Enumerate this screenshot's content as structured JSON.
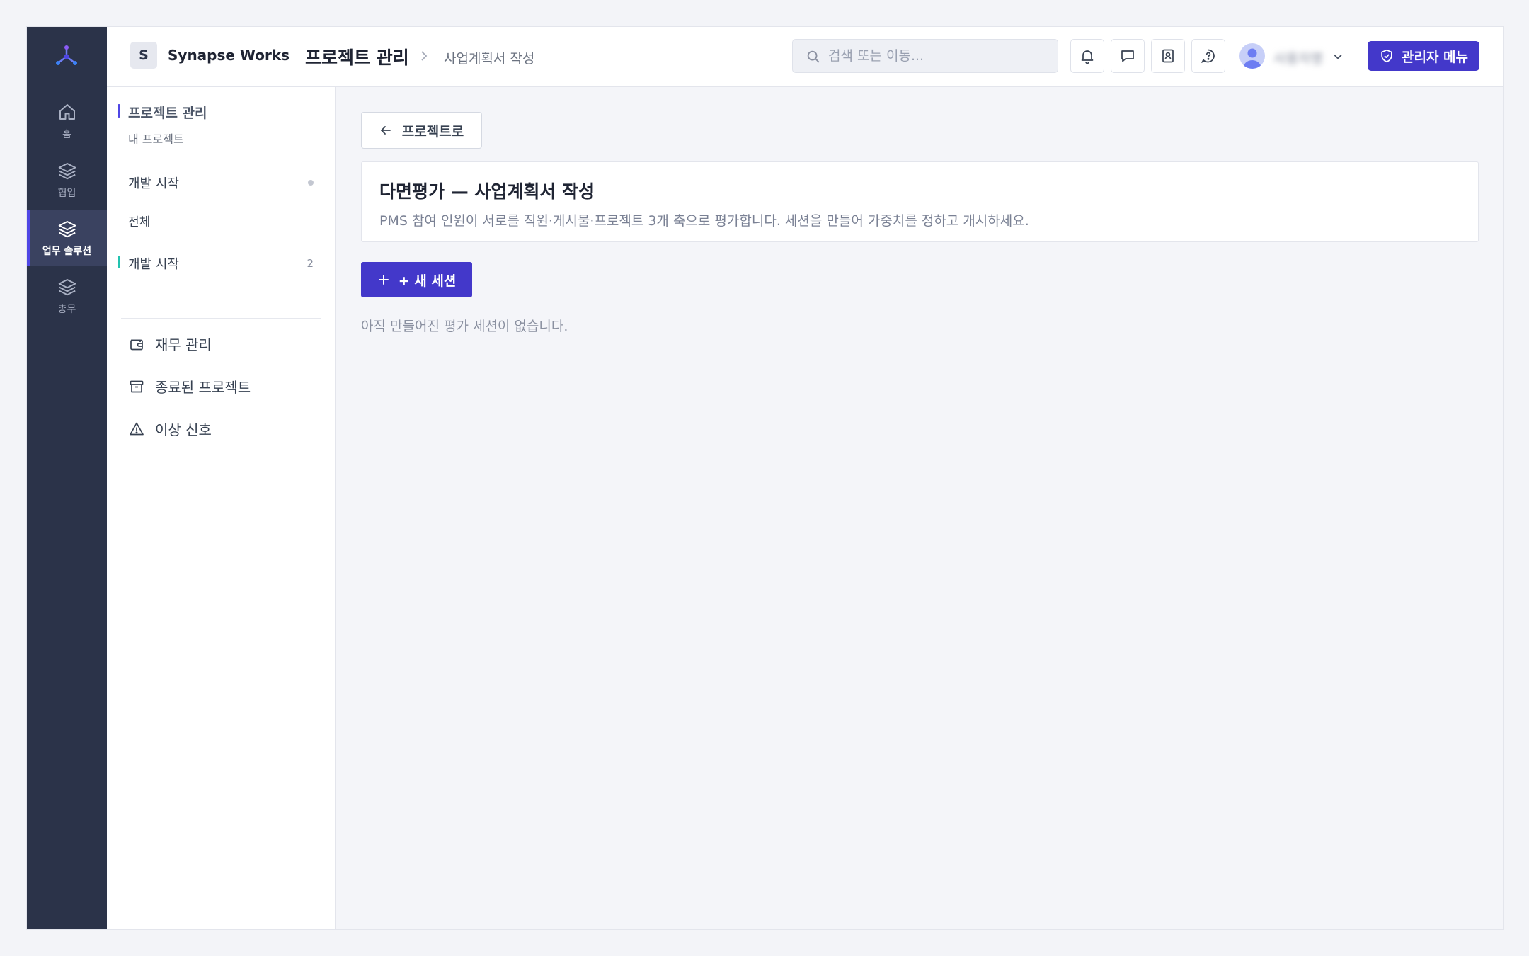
{
  "workspace": {
    "badge": "S",
    "name": "Synapse Works"
  },
  "header": {
    "title": "프로젝트 관리",
    "breadcrumb": "사업계획서 작성",
    "search_placeholder": "검색 또는 이동...",
    "user_name": "사용자명",
    "admin_button": "관리자 메뉴"
  },
  "rail": {
    "items": [
      {
        "label": "홈",
        "icon": "home-icon"
      },
      {
        "label": "협업",
        "icon": "layers-icon"
      },
      {
        "label": "업무 솔루션",
        "icon": "layers-icon",
        "active": true
      },
      {
        "label": "총무",
        "icon": "layers-icon"
      }
    ]
  },
  "sidebar": {
    "section_title": "프로젝트 관리",
    "section_sub": "내 프로젝트",
    "group_label": "개발 시작",
    "all_label": "전체",
    "project_label": "개발 시작",
    "project_count": "2",
    "links": [
      {
        "label": "재무 관리",
        "icon": "wallet-icon"
      },
      {
        "label": "종료된 프로젝트",
        "icon": "archive-icon"
      },
      {
        "label": "이상 신호",
        "icon": "warning-icon"
      }
    ]
  },
  "main": {
    "back_button": "프로젝트로",
    "card_title": "다면평가 — 사업계획서 작성",
    "card_desc": "PMS 참여 인원이 서로를 직원·게시물·프로젝트 3개 축으로 평가합니다. 세션을 만들어 가중치를 정하고 개시하세요.",
    "new_session_button": "+ 새 세션",
    "empty_text": "아직 만들어진 평가 세션이 없습니다."
  },
  "colors": {
    "accent": "#4338ca",
    "rail_bg": "#2b3349",
    "teal": "#22c3b0"
  }
}
